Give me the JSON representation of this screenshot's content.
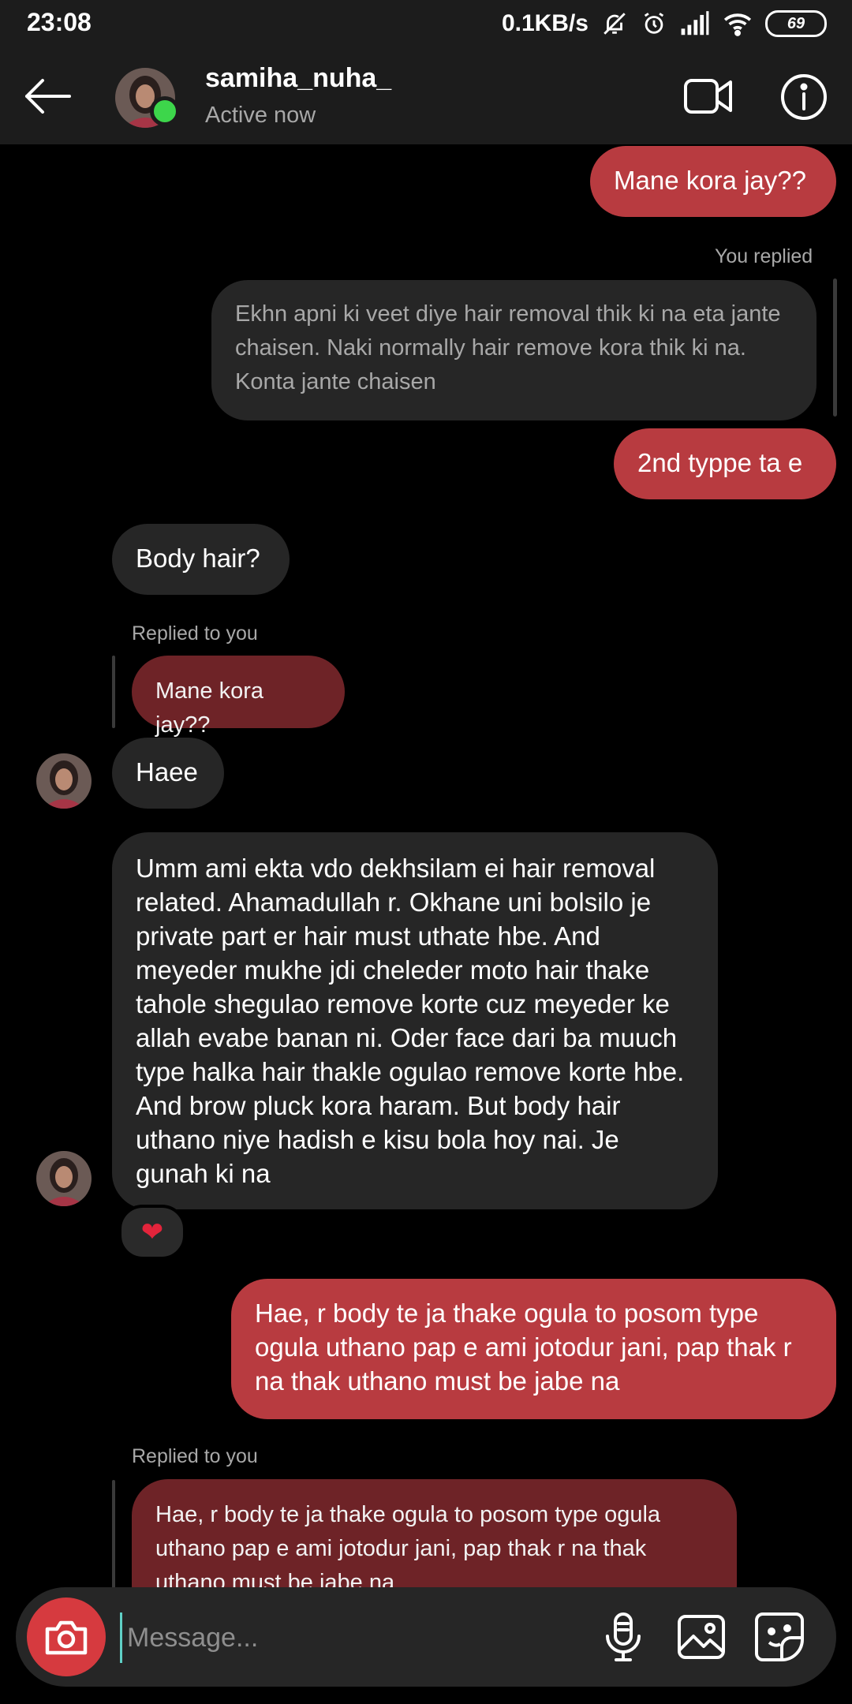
{
  "status_bar": {
    "time": "23:08",
    "net_speed": "0.1KB/s",
    "battery": "69",
    "icons": [
      "bell-off-icon",
      "alarm-icon",
      "signal-icon",
      "wifi-icon",
      "battery-icon"
    ]
  },
  "header": {
    "username": "samiha_nuha_",
    "status": "Active now",
    "icons": [
      "back-arrow-icon",
      "video-call-icon",
      "info-icon"
    ]
  },
  "thread": {
    "m1": {
      "text": "Mane kora jay??"
    },
    "m2": {
      "caption": "You replied",
      "quote": "Ekhn apni ki veet diye hair removal thik ki na eta jante chaisen. Naki normally hair remove kora thik ki na. Konta jante chaisen"
    },
    "m3": {
      "text": "2nd typpe ta e"
    },
    "m4": {
      "text": "Body hair?"
    },
    "m5": {
      "caption": "Replied to you",
      "quote": "Mane kora jay??",
      "text": "Haee"
    },
    "m6": {
      "text": "Umm ami ekta vdo dekhsilam ei hair removal related. Ahamadullah r. Okhane uni bolsilo je private part er hair must uthate hbe. And meyeder mukhe jdi cheleder moto hair thake tahole shegulao remove korte cuz meyeder ke allah evabe banan ni. Oder face dari ba muuch type halka hair thakle ogulao remove korte hbe. And brow pluck kora haram. But body hair uthano niye hadish e kisu bola hoy nai. Je gunah ki na",
      "reaction": "❤"
    },
    "m7": {
      "text": "Hae, r body te ja thake ogula to posom type ogula uthano pap e ami jotodur jani, pap thak r na thak uthano must be jabe na"
    },
    "m8": {
      "caption": "Replied to you",
      "quote": "Hae, r body te ja thake ogula to posom type ogula uthano pap e ami jotodur jani, pap thak r na thak uthano must be jabe na"
    }
  },
  "composer": {
    "placeholder": "Message...",
    "icons": [
      "camera-icon",
      "microphone-icon",
      "gallery-icon",
      "sticker-icon"
    ]
  },
  "colors": {
    "outgoing_bubble": "#b83b40",
    "incoming_bubble": "#262626",
    "reply_quote_outgoing": "#6e2327",
    "header_bg": "#1c1c1c",
    "online": "#3dd64b",
    "camera_button": "#d63a3f"
  }
}
